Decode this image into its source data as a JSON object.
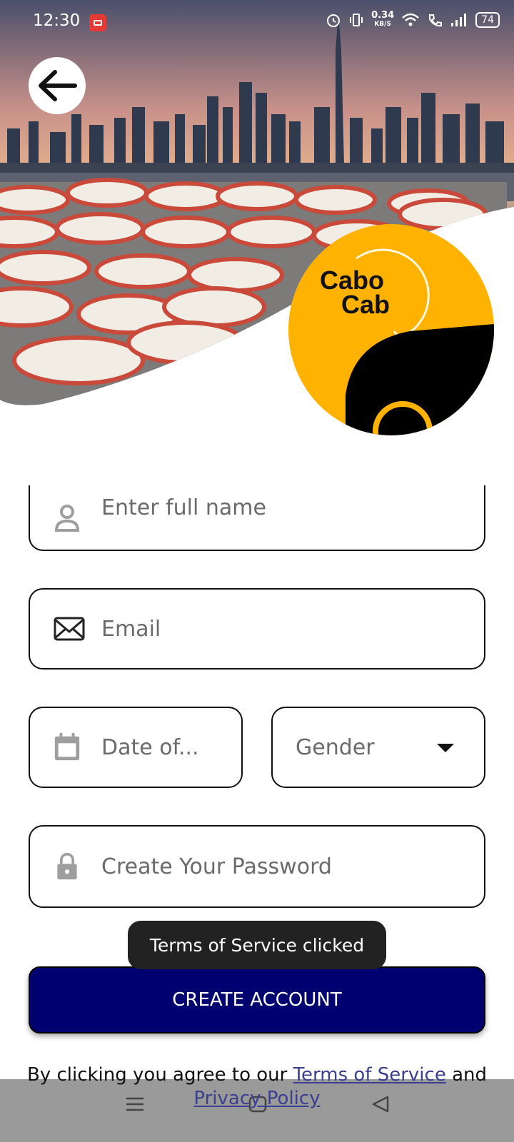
{
  "status_bar": {
    "time": "12:30",
    "net_speed_value": "0.34",
    "net_speed_unit": "KB/S",
    "battery": "74"
  },
  "logo": {
    "line1": "Cabo",
    "line2": "Cab"
  },
  "form": {
    "full_name_placeholder": "Enter full name",
    "email_placeholder": "Email",
    "dob_placeholder": "Date of...",
    "gender_placeholder": "Gender",
    "password_placeholder": "Create Your Password"
  },
  "toast": "Terms of Service clicked",
  "create_account_label": "CREATE ACCOUNT",
  "terms": {
    "prefix": "By clicking you agree to our ",
    "terms_link": "Terms of Service",
    "and": " and ",
    "privacy_link": "Privacy Policy"
  },
  "colors": {
    "accent_yellow": "#FFB300",
    "button_navy": "#000070"
  }
}
